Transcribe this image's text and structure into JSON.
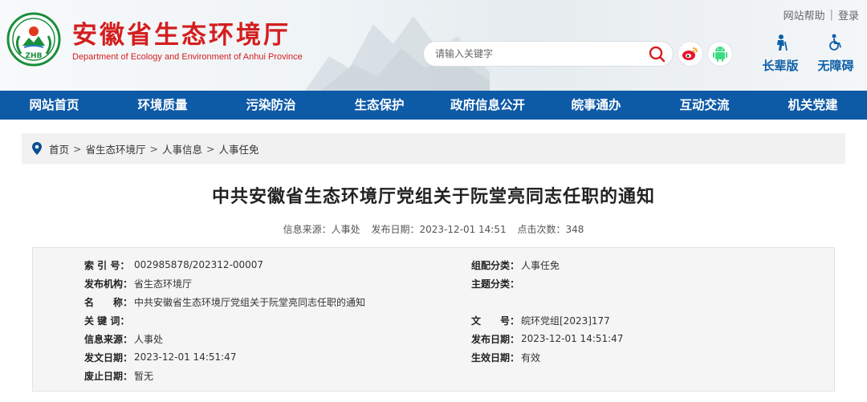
{
  "site": {
    "title": "安徽省生态环境厅",
    "subtitle": "Department of Ecology and Environment of Anhui Province",
    "logo_text": "ZHB"
  },
  "top_links": {
    "help": "网站帮助",
    "login": "登录"
  },
  "search": {
    "placeholder": "请输入关键字",
    "icon": "search-icon"
  },
  "social": [
    {
      "name": "weibo-icon",
      "color": "#e6162d"
    },
    {
      "name": "android-icon",
      "color": "#3ddc84"
    }
  ],
  "modes": {
    "elder": "长辈版",
    "accessible": "无障碍"
  },
  "nav": [
    "网站首页",
    "环境质量",
    "污染防治",
    "生态保护",
    "政府信息公开",
    "皖事通办",
    "互动交流",
    "机关党建"
  ],
  "breadcrumb": [
    "首页",
    "省生态环境厅",
    "人事信息",
    "人事任免"
  ],
  "article": {
    "title": "中共安徽省生态环境厅党组关于阮堂亮同志任职的通知",
    "meta": {
      "source": "信息来源：人事处",
      "date": "发布日期：2023-12-01 14:51",
      "views": "点击次数：348"
    }
  },
  "info": {
    "index_no": {
      "label": "索 引 号：",
      "value": "002985878/202312-00007"
    },
    "org_category": {
      "label": "组配分类：",
      "value": "人事任免"
    },
    "publisher": {
      "label": "发布机构：",
      "value": "省生态环境厅"
    },
    "topic": {
      "label": "主题分类：",
      "value": ""
    },
    "name": {
      "label": "名　　称：",
      "value": "中共安徽省生态环境厅党组关于阮堂亮同志任职的通知"
    },
    "keywords": {
      "label": "关 键 词：",
      "value": ""
    },
    "doc_no": {
      "label": "文　　号：",
      "value": "皖环党组[2023]177"
    },
    "source": {
      "label": "信息来源：",
      "value": "人事处"
    },
    "publish_date": {
      "label": "发布日期：",
      "value": "2023-12-01 14:51:47"
    },
    "issue_date": {
      "label": "发文日期：",
      "value": "2023-12-01 14:51:47"
    },
    "effective_date": {
      "label": "生效日期：",
      "value": "有效"
    },
    "expire_date": {
      "label": "废止日期：",
      "value": "暂无"
    }
  },
  "colors": {
    "brand_red": "#d41e1e",
    "nav_blue": "#0d5aa7",
    "accent_blue": "#0d5fa8"
  }
}
